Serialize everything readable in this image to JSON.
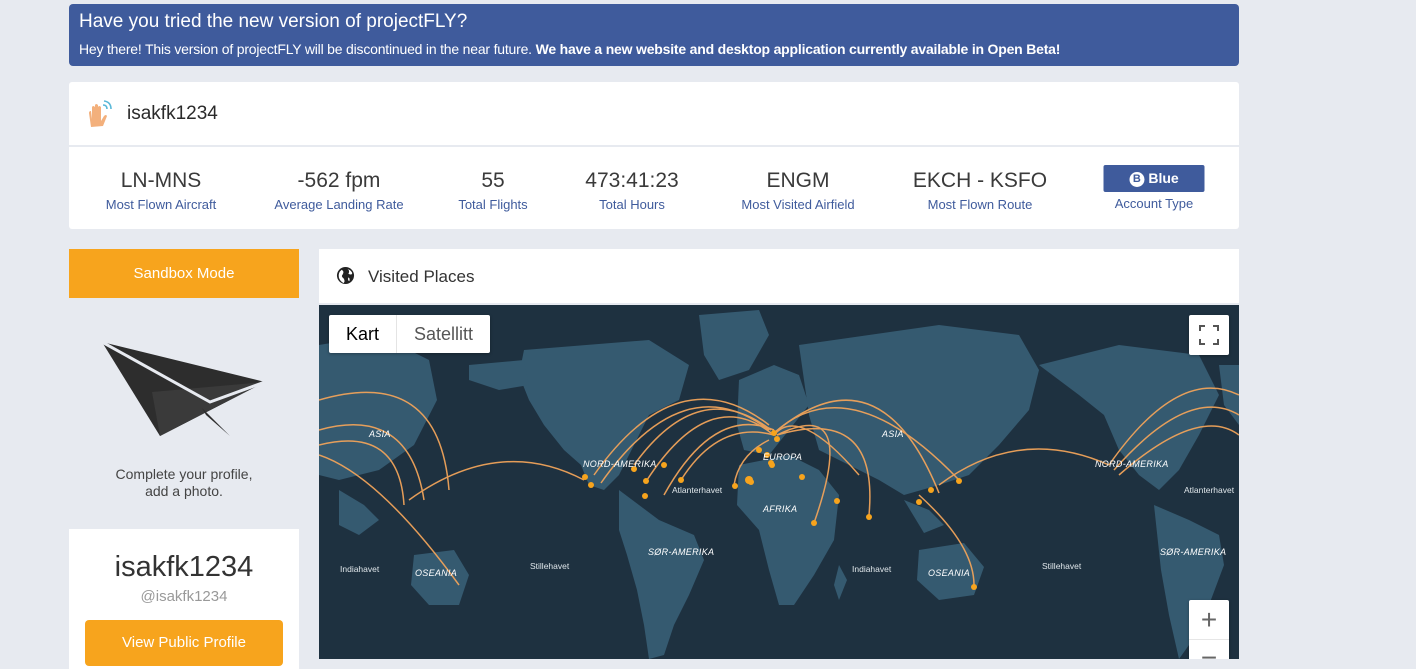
{
  "banner": {
    "title": "Have you tried the new version of projectFLY?",
    "text": "Hey there! This version of projectFLY will be discontinued in the near future.",
    "bold_text": "We have a new website and desktop application currently available in Open Beta!"
  },
  "profile": {
    "username": "isakfk1234",
    "icon": "waving-hand-icon"
  },
  "stats": [
    {
      "value": "LN-MNS",
      "label": "Most Flown Aircraft"
    },
    {
      "value": "-562 fpm",
      "label": "Average Landing Rate"
    },
    {
      "value": "55",
      "label": "Total Flights"
    },
    {
      "value": "473:41:23",
      "label": "Total Hours"
    },
    {
      "value": "ENGM",
      "label": "Most Visited Airfield"
    },
    {
      "value": "EKCH - KSFO",
      "label": "Most Flown Route"
    }
  ],
  "account": {
    "badge_letter": "B",
    "badge": "Blue",
    "label": "Account Type"
  },
  "sidebar": {
    "sandbox": "Sandbox Mode",
    "complete_line1": "Complete your profile,",
    "complete_line2": "add a photo.",
    "username": "isakfk1234",
    "handle": "@isakfk1234",
    "view_profile": "View Public Profile"
  },
  "visited": {
    "title": "Visited Places",
    "icon": "globe-icon"
  },
  "map": {
    "type_map": "Kart",
    "type_satellite": "Satellitt",
    "zoom_in": "+",
    "zoom_out": "−",
    "labels": {
      "asia1": "ASIA",
      "north_america1": "NORD-AMERIKA",
      "europe": "EUROPA",
      "atlantic1": "Atlanterhavet",
      "africa": "AFRIKA",
      "asia2": "ASIA",
      "north_america2": "NORD-AMERIKA",
      "atlantic2": "Atlanterhavet",
      "south_america1": "SØR-AMERIKA",
      "south_america2": "SØR-AMERIKA",
      "indian1": "Indiahavet",
      "indian2": "Indiahavet",
      "oceania1": "OSEANIA",
      "oceania2": "OSEANIA",
      "pacific1": "Stillehavet",
      "pacific2": "Stillehavet"
    },
    "colors": {
      "water": "#1e3140",
      "land": "#355a70",
      "route": "#f0a35a",
      "dot": "#f7a41d"
    }
  }
}
